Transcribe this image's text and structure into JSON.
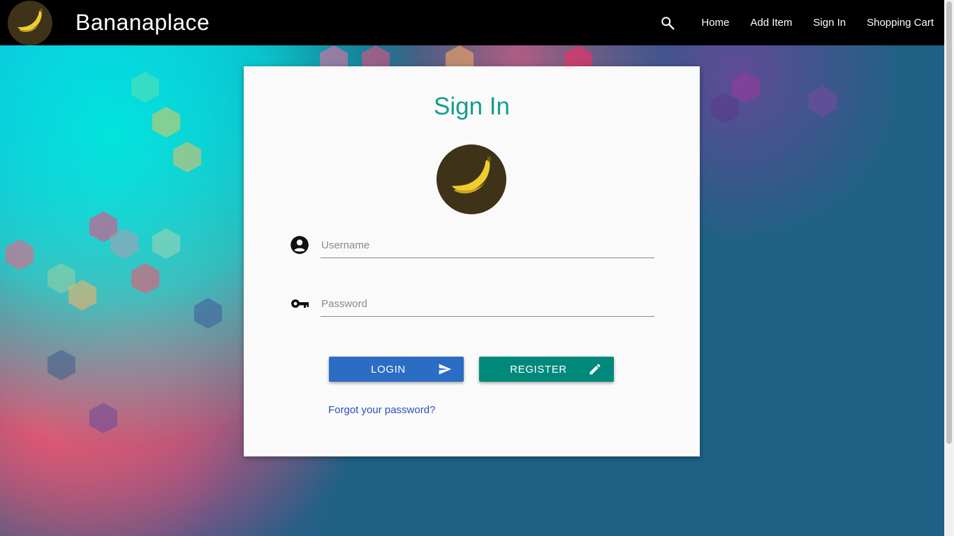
{
  "app": {
    "brand": "Bananaplace"
  },
  "nav": {
    "items": [
      {
        "label": "Home"
      },
      {
        "label": "Add Item"
      },
      {
        "label": "Sign In"
      },
      {
        "label": "Shopping Cart"
      }
    ],
    "search_icon": "search-icon"
  },
  "signin": {
    "title": "Sign In",
    "username": {
      "placeholder": "Username",
      "value": "",
      "icon": "account-circle-icon"
    },
    "password": {
      "placeholder": "Password",
      "value": "",
      "icon": "key-icon"
    },
    "login_label": "LOGIN",
    "login_icon": "send-icon",
    "register_label": "REGISTER",
    "register_icon": "pencil-icon",
    "forgot_link": "Forgot your password?"
  },
  "colors": {
    "navbar": "#000000",
    "title": "#159d8f",
    "login_button": "#2b6cc4",
    "register_button": "#00897b",
    "link": "#2c50b8",
    "logo_bg": "#3e3219",
    "page_bg": "#1e6184"
  }
}
